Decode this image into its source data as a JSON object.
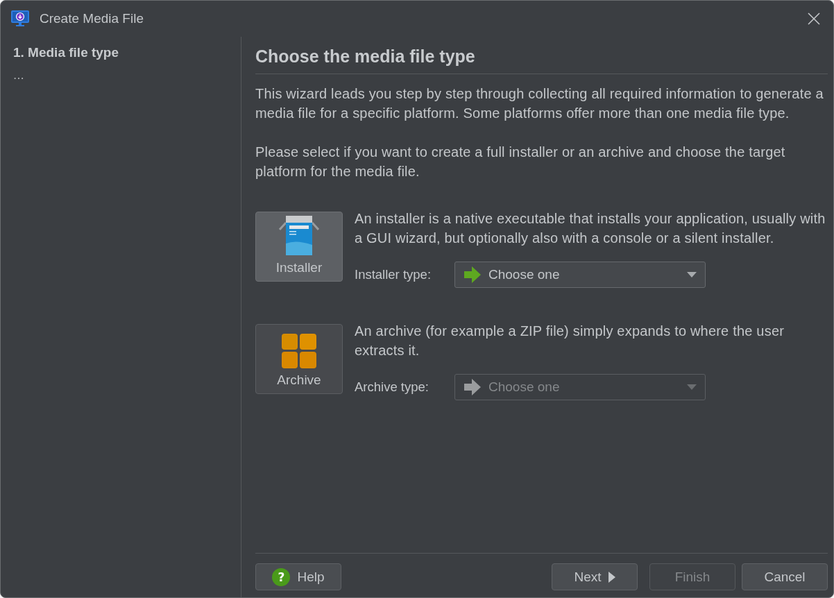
{
  "window": {
    "title": "Create Media File"
  },
  "steps": [
    {
      "label": "1. Media file type",
      "selected": true
    },
    {
      "label": "...",
      "selected": false
    }
  ],
  "page": {
    "heading": "Choose the media file type",
    "paragraphs": [
      "This wizard leads you step by step through collecting all required information to generate a media file for a specific platform. Some platforms offer more than one media file type.",
      "Please select if you want to create a full installer or an archive and choose the target platform for the media file."
    ]
  },
  "options": [
    {
      "kind": "installer",
      "label": "Installer",
      "selected": true,
      "description": "An installer is a native executable that installs your application, usually with a GUI wizard, but optionally also with a console or a silent installer.",
      "field_label": "Installer type:",
      "dropdown": {
        "value": "Choose one",
        "disabled": false
      }
    },
    {
      "kind": "archive",
      "label": "Archive",
      "selected": false,
      "description": "An archive (for example a ZIP file) simply expands to where the user extracts it.",
      "field_label": "Archive type:",
      "dropdown": {
        "value": "Choose one",
        "disabled": true
      }
    }
  ],
  "buttons": [
    {
      "kind": "help",
      "label": "Help",
      "icon": "?",
      "disabled": false
    },
    {
      "kind": "next",
      "label": "Next",
      "disabled": false
    },
    {
      "kind": "finish",
      "label": "Finish",
      "disabled": true
    },
    {
      "kind": "cancel",
      "label": "Cancel",
      "disabled": false
    }
  ]
}
